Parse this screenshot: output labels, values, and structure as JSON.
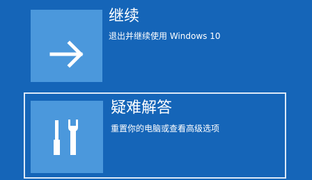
{
  "colors": {
    "background": "#1565b8",
    "tile": "#4b98dc",
    "selected_border": "#dce9f7",
    "text": "#ffffff"
  },
  "options": [
    {
      "title": "继续",
      "description": "退出并继续使用 Windows 10",
      "icon": "arrow-right-icon"
    },
    {
      "title": "疑难解答",
      "description": "重置你的电脑或查看高级选项",
      "icon": "tools-icon",
      "selected": true
    }
  ]
}
